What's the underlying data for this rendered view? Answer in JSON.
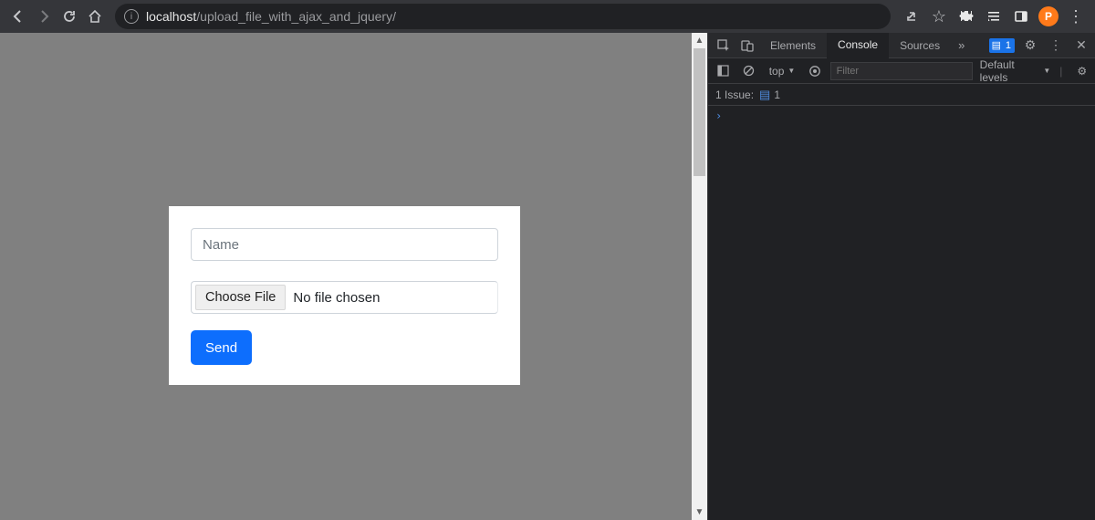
{
  "chrome": {
    "url_host": "localhost",
    "url_path": "/upload_file_with_ajax_and_jquery/",
    "avatar_initial": "P"
  },
  "form": {
    "name_placeholder": "Name",
    "name_value": "",
    "choose_file_label": "Choose File",
    "file_status": "No file chosen",
    "send_label": "Send"
  },
  "devtools": {
    "tabs": [
      "Elements",
      "Console",
      "Sources"
    ],
    "active_tab": "Console",
    "badge_count": "1",
    "context_label": "top",
    "filter_placeholder": "Filter",
    "levels_label": "Default levels",
    "issue_label": "1 Issue:",
    "issue_count": "1",
    "prompt": "›"
  }
}
